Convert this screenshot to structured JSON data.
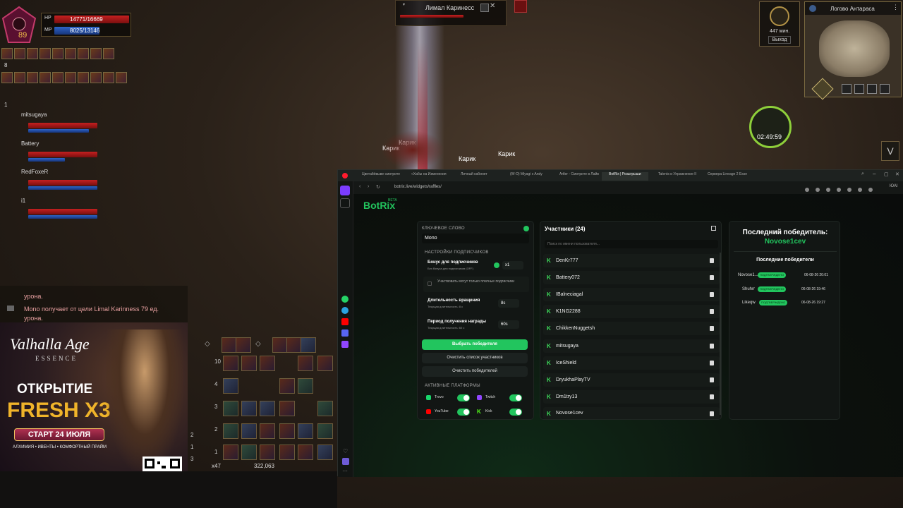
{
  "game": {
    "hp_label": "HP",
    "hp_value": "14771/16669",
    "mp_label": "MP",
    "mp_value": "8025/13146",
    "level": "89",
    "party_count": "8",
    "party_index": "1",
    "target_name": "Лимал Каринесс",
    "zone_name": "Логово Антараса",
    "timer_minutes": "447 мин.",
    "exit_label": "Выход",
    "clock": "02:49:59",
    "party": [
      {
        "name": "mitsugaya"
      },
      {
        "name": "Battery"
      },
      {
        "name": "RedFoxeR"
      },
      {
        "name": "i1"
      }
    ],
    "chat_line_1": "урона.",
    "chat_line_2": "Mono получает от цели Limal Karinness 79 ед.",
    "chat_line_3": "урона.",
    "npc_label": "Карик",
    "adena_count": "x47",
    "adena_value": "322,063",
    "hotbar_rows": [
      "10",
      "4",
      "3",
      "2",
      "1"
    ],
    "page_numbers": [
      "2",
      "3",
      "1"
    ]
  },
  "ad": {
    "brand": "Valhalla Age",
    "brand_sub": "ESSENCE",
    "headline": "ОТКРЫТИЕ",
    "rate": "FRESH X3",
    "start": "СТАРТ 24 ИЮЛЯ",
    "features": "АЛХИМИЯ • ИВЕНТЫ • КОМФОРТНЫЙ ПРАЙМ"
  },
  "browser": {
    "tabs": [
      "Цветайёвыве смотрите",
      "«Хабы на Изменения",
      "Личный кабинет",
      "(W-O) Miyagi x Andy",
      "Artler - Смотрите в Лайв",
      "BotRix | Розыгрыши",
      "Talents и Упражнение II",
      "Сервера Lineage 2 Essenc"
    ],
    "url": "botrix.live/widgets/raffles/",
    "user_label": "ЮАI"
  },
  "botrix": {
    "logo": "BotRix",
    "logo_badge": "BETA",
    "keyword_label": "КЛЮЧЕВОЕ СЛОВО",
    "keyword_value": "Mono",
    "sub_settings_label": "НАСТРОЙКИ ПОДПИСЧИКОВ",
    "sub_bonus_title": "Бонус для подписчиков",
    "sub_bonus_desc": "Без бонуса для подписчиков (OFF)",
    "sub_bonus_value": "x1",
    "paid_only_text": "Участвовать могут только платные подписчики",
    "spin_title": "Длительность вращения",
    "spin_desc": "Текущая длительность: 8 с",
    "spin_value": "8s",
    "claim_title": "Период получения награды",
    "claim_desc": "Текущая длительность: 60 с",
    "claim_value": "60s",
    "pick_winner": "Выбрать победителя",
    "clear_participants": "Очистить список участников",
    "clear_winners": "Очистить победителей",
    "platforms_label": "АКТИВНЫЕ ПЛАТФОРМЫ",
    "platforms": [
      {
        "name": "Trovo",
        "color": "#19d66b"
      },
      {
        "name": "Twitch",
        "color": "#9146ff"
      },
      {
        "name": "YouTube",
        "color": "#ff0000"
      },
      {
        "name": "Kick",
        "color": "#53fc18"
      }
    ],
    "participants_title": "Участники (24)",
    "search_placeholder": "Поиск по имени пользователя...",
    "participants": [
      "DenKr777",
      "Battery072",
      "IBalneciagal",
      "K1NG2288",
      "ChikkenNuggetsh",
      "mitsugaya",
      "IceShield",
      "DryukhaPlayTV",
      "Dm1try13",
      "Novose1cev"
    ],
    "last_winner_label": "Последний победитель:",
    "last_winner": "Novose1cev",
    "recent_winners_label": "Последние победители",
    "winners": [
      {
        "name": "Novose1...",
        "status": "ПОДТВЕРЖДЕНО",
        "time": "06-08-26 20:01"
      },
      {
        "name": "Shuhrr",
        "status": "ПОДТВЕРЖДЕНО",
        "time": "06-08-26 19:46"
      },
      {
        "name": "Likeqw",
        "status": "ПОДТВЕРЖДЕНО",
        "time": "06-08-26 19:27"
      }
    ],
    "accent": "#22c55e"
  }
}
